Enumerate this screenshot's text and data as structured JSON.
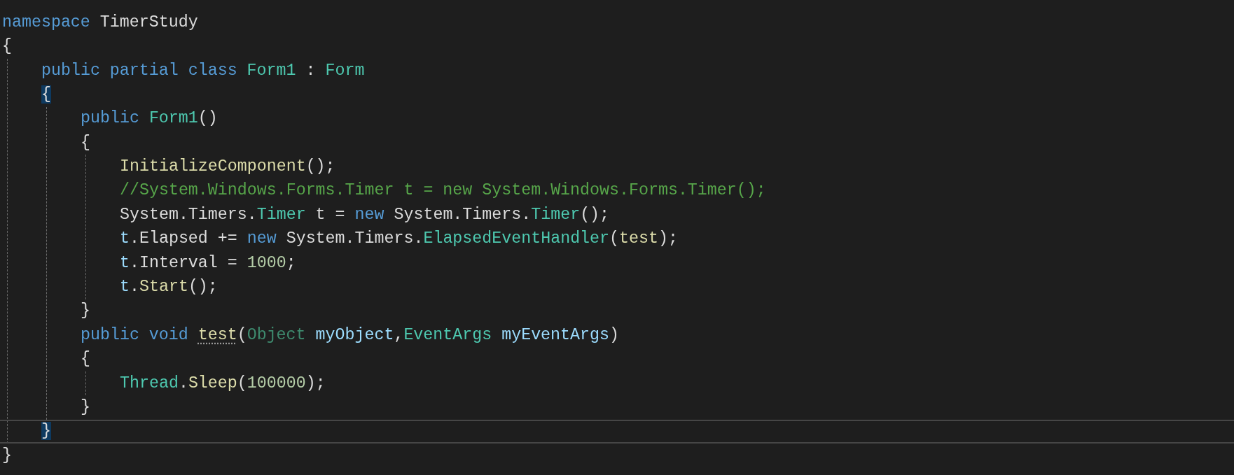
{
  "editor": {
    "lines": [
      {
        "current": false,
        "tokens": [
          {
            "text": "namespace",
            "kind": "keyword"
          },
          {
            "text": " TimerStudy",
            "kind": "plain"
          }
        ]
      },
      {
        "current": false,
        "tokens": [
          {
            "text": "{",
            "kind": "plain"
          }
        ],
        "children": [
          {
            "current": false,
            "tokens": [
              {
                "text": "public partial class ",
                "kind": "keyword"
              },
              {
                "text": "Form1",
                "kind": "type"
              },
              {
                "text": " : ",
                "kind": "plain"
              },
              {
                "text": "Form",
                "kind": "type"
              }
            ]
          },
          {
            "current": false,
            "tokens": [
              {
                "text": "{",
                "kind": "brace-match"
              }
            ],
            "children": [
              {
                "current": false,
                "tokens": [
                  {
                    "text": "public ",
                    "kind": "keyword"
                  },
                  {
                    "text": "Form1",
                    "kind": "type"
                  },
                  {
                    "text": "()",
                    "kind": "plain"
                  }
                ]
              },
              {
                "current": false,
                "tokens": [
                  {
                    "text": "{",
                    "kind": "plain"
                  }
                ],
                "children": [
                  {
                    "current": false,
                    "tokens": [
                      {
                        "text": "InitializeComponent",
                        "kind": "method"
                      },
                      {
                        "text": "();",
                        "kind": "plain"
                      }
                    ]
                  },
                  {
                    "current": false,
                    "tokens": [
                      {
                        "text": "//System.Windows.Forms.Timer t = new System.Windows.Forms.Timer();",
                        "kind": "comment"
                      }
                    ]
                  },
                  {
                    "current": false,
                    "tokens": [
                      {
                        "text": "System.Timers.",
                        "kind": "plain"
                      },
                      {
                        "text": "Timer",
                        "kind": "type"
                      },
                      {
                        "text": " t = ",
                        "kind": "plain"
                      },
                      {
                        "text": "new",
                        "kind": "keyword"
                      },
                      {
                        "text": " System.Timers.",
                        "kind": "plain"
                      },
                      {
                        "text": "Timer",
                        "kind": "type"
                      },
                      {
                        "text": "();",
                        "kind": "plain"
                      }
                    ]
                  },
                  {
                    "current": false,
                    "tokens": [
                      {
                        "text": "t",
                        "kind": "variable"
                      },
                      {
                        "text": ".Elapsed += ",
                        "kind": "plain"
                      },
                      {
                        "text": "new",
                        "kind": "keyword"
                      },
                      {
                        "text": " System.Timers.",
                        "kind": "plain"
                      },
                      {
                        "text": "ElapsedEventHandler",
                        "kind": "type"
                      },
                      {
                        "text": "(",
                        "kind": "plain"
                      },
                      {
                        "text": "test",
                        "kind": "method"
                      },
                      {
                        "text": ");",
                        "kind": "plain"
                      }
                    ]
                  },
                  {
                    "current": false,
                    "tokens": [
                      {
                        "text": "t",
                        "kind": "variable"
                      },
                      {
                        "text": ".Interval = ",
                        "kind": "plain"
                      },
                      {
                        "text": "1000",
                        "kind": "number"
                      },
                      {
                        "text": ";",
                        "kind": "plain"
                      }
                    ]
                  },
                  {
                    "current": false,
                    "tokens": [
                      {
                        "text": "t",
                        "kind": "variable"
                      },
                      {
                        "text": ".",
                        "kind": "plain"
                      },
                      {
                        "text": "Start",
                        "kind": "method"
                      },
                      {
                        "text": "();",
                        "kind": "plain"
                      }
                    ]
                  }
                ]
              },
              {
                "current": false,
                "tokens": [
                  {
                    "text": "}",
                    "kind": "plain"
                  }
                ]
              },
              {
                "current": false,
                "tokens": [
                  {
                    "text": "public void ",
                    "kind": "keyword"
                  },
                  {
                    "text": "test",
                    "kind": "method-hint"
                  },
                  {
                    "text": "(",
                    "kind": "plain"
                  },
                  {
                    "text": "Object ",
                    "kind": "faded-type"
                  },
                  {
                    "text": "myObject",
                    "kind": "variable"
                  },
                  {
                    "text": ",",
                    "kind": "plain"
                  },
                  {
                    "text": "EventArgs ",
                    "kind": "type"
                  },
                  {
                    "text": "myEventArgs",
                    "kind": "variable"
                  },
                  {
                    "text": ")",
                    "kind": "plain"
                  }
                ]
              },
              {
                "current": false,
                "tokens": [
                  {
                    "text": "{",
                    "kind": "plain"
                  }
                ],
                "children": [
                  {
                    "current": false,
                    "tokens": [
                      {
                        "text": "Thread",
                        "kind": "type"
                      },
                      {
                        "text": ".",
                        "kind": "plain"
                      },
                      {
                        "text": "Sleep",
                        "kind": "method"
                      },
                      {
                        "text": "(",
                        "kind": "plain"
                      },
                      {
                        "text": "100000",
                        "kind": "number"
                      },
                      {
                        "text": ");",
                        "kind": "plain"
                      }
                    ]
                  }
                ]
              },
              {
                "current": false,
                "tokens": [
                  {
                    "text": "}",
                    "kind": "plain"
                  }
                ]
              }
            ]
          },
          {
            "current": true,
            "tokens": [
              {
                "text": "}",
                "kind": "brace-match"
              }
            ]
          }
        ]
      },
      {
        "current": false,
        "tokens": [
          {
            "text": "}",
            "kind": "plain"
          }
        ]
      }
    ]
  }
}
